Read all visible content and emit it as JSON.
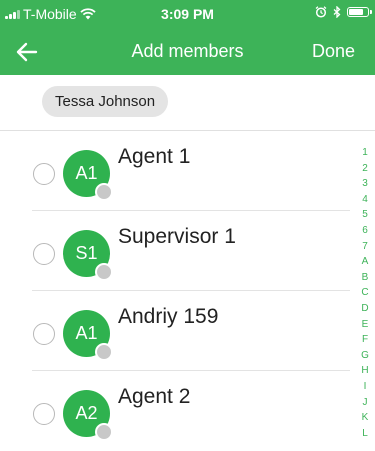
{
  "status_bar": {
    "carrier": "T-Mobile",
    "time": "3:09 PM",
    "battery_level": 0.8
  },
  "nav": {
    "title": "Add members",
    "done_label": "Done",
    "back_icon": "arrow-left-icon"
  },
  "selected_chip": "Tessa Johnson",
  "contacts": [
    {
      "initials": "A1",
      "name": "Agent 1"
    },
    {
      "initials": "S1",
      "name": "Supervisor 1"
    },
    {
      "initials": "A1",
      "name": "Andriy 159"
    },
    {
      "initials": "A2",
      "name": "Agent 2"
    }
  ],
  "index_letters": [
    "1",
    "2",
    "3",
    "4",
    "5",
    "6",
    "7",
    "A",
    "B",
    "C",
    "D",
    "E",
    "F",
    "G",
    "H",
    "I",
    "J",
    "K",
    "L"
  ],
  "colors": {
    "brand_green": "#3db358",
    "avatar_green": "#2fb24f",
    "presence_gray": "#c8c8c8"
  }
}
